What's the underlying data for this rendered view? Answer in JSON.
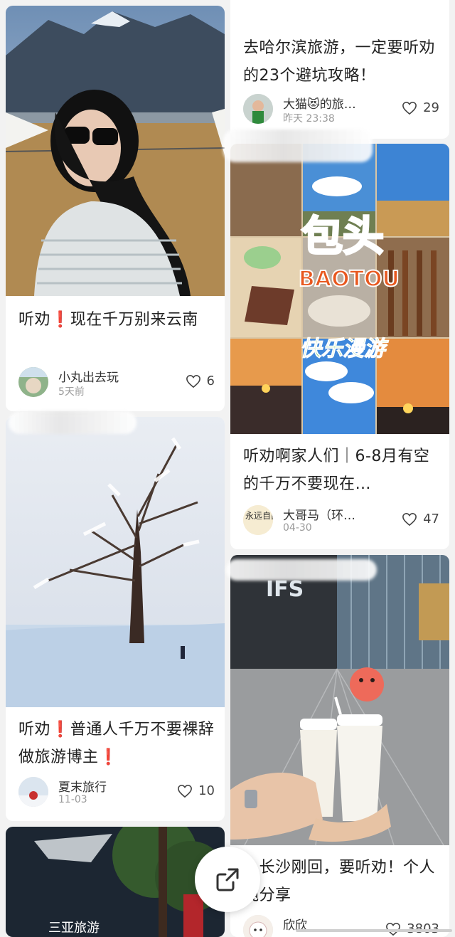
{
  "cards": [
    {
      "title_a": "听劝",
      "title_mark": "❗",
      "title_b": "现在千万别来云南",
      "author": "小丸出去玩",
      "time": "5天前",
      "likes": "6"
    },
    {
      "title": "去哈尔滨旅游，一定要听劝的23个避坑攻略！",
      "author": "大猫😻的旅…",
      "time": "昨天 23:38",
      "likes": "29"
    },
    {
      "img_big": "包头",
      "img_sub": "BAOTOU",
      "img_script": "快乐漫游",
      "title": "听劝啊家人们｜6-8月有空的千万不要现在…",
      "author": "大哥马（环…",
      "time": "04-30",
      "likes": "47",
      "avatar_text": "永远自由"
    },
    {
      "title_a": "听劝",
      "title_mark": "❗",
      "title_b": "普通人千万不要裸辞做旅游博主",
      "title_end": "❗",
      "author": "夏末旅行",
      "time": "11-03",
      "likes": "10"
    },
    {
      "sign_text": "IFS",
      "title": "人长沙刚回，要听劝！个人纯分享",
      "author": "欣欣",
      "likes": "3803"
    },
    {
      "img_text": "三亚旅游"
    }
  ],
  "colors": {
    "warn": "#e0202a",
    "background": "#f2f2f2"
  },
  "icons": {
    "like": "heart-outline-icon",
    "share": "share-external-icon"
  }
}
